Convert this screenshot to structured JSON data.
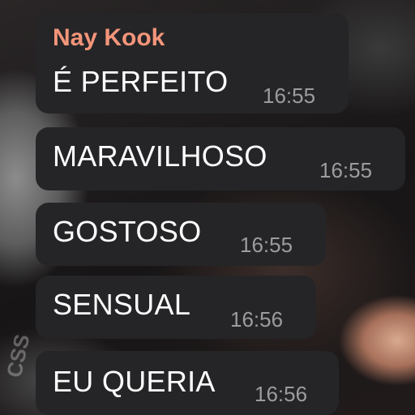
{
  "chat": {
    "sender_name": "Nay Kook",
    "sender_color": "#f4957a",
    "messages": [
      {
        "text": "É PERFEITO",
        "time": "16:55"
      },
      {
        "text": "MARAVILHOSO",
        "time": "16:55"
      },
      {
        "text": "GOSTOSO",
        "time": "16:55"
      },
      {
        "text": "SENSUAL",
        "time": "16:56"
      },
      {
        "text": "EU QUERIA",
        "time": "16:56"
      }
    ]
  },
  "background": {
    "wallpaper_text": "CSS"
  },
  "colors": {
    "bubble": "#252527",
    "message_text": "#ffffff",
    "timestamp": "#9c9c9e"
  }
}
